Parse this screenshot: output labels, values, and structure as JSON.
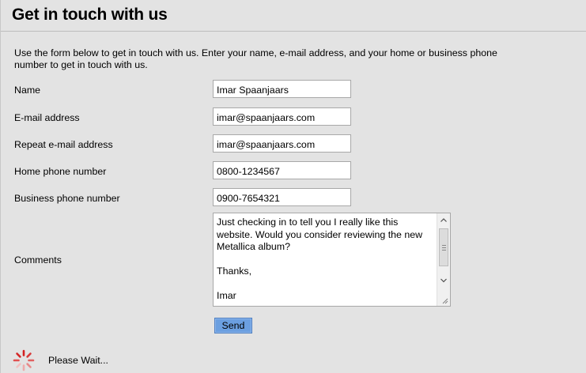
{
  "page": {
    "title": "Get in touch with us",
    "intro_line1": "Use the form below to get in touch with us. Enter your name, e-mail address, and your home or business phone",
    "intro_line2": "number to get in touch with us."
  },
  "form": {
    "name": {
      "label": "Name",
      "value": "Imar Spaanjaars"
    },
    "email": {
      "label": "E-mail address",
      "value": "imar@spaanjaars.com"
    },
    "email_repeat": {
      "label": "Repeat e-mail address",
      "value": "imar@spaanjaars.com"
    },
    "home_phone": {
      "label": "Home phone number",
      "value": "0800-1234567"
    },
    "business_phone": {
      "label": "Business phone number",
      "value": "0900-7654321"
    },
    "comments": {
      "label": "Comments",
      "value": "Just checking in to tell you I really like this website. Would you consider reviewing the new Metallica album?\n\nThanks,\n\nImar"
    },
    "send_label": "Send"
  },
  "status": {
    "wait_text": "Please Wait..."
  },
  "colors": {
    "panel_background": "#e3e3e3",
    "send_button": "#6b9fe0",
    "spinner": "#d32020"
  }
}
